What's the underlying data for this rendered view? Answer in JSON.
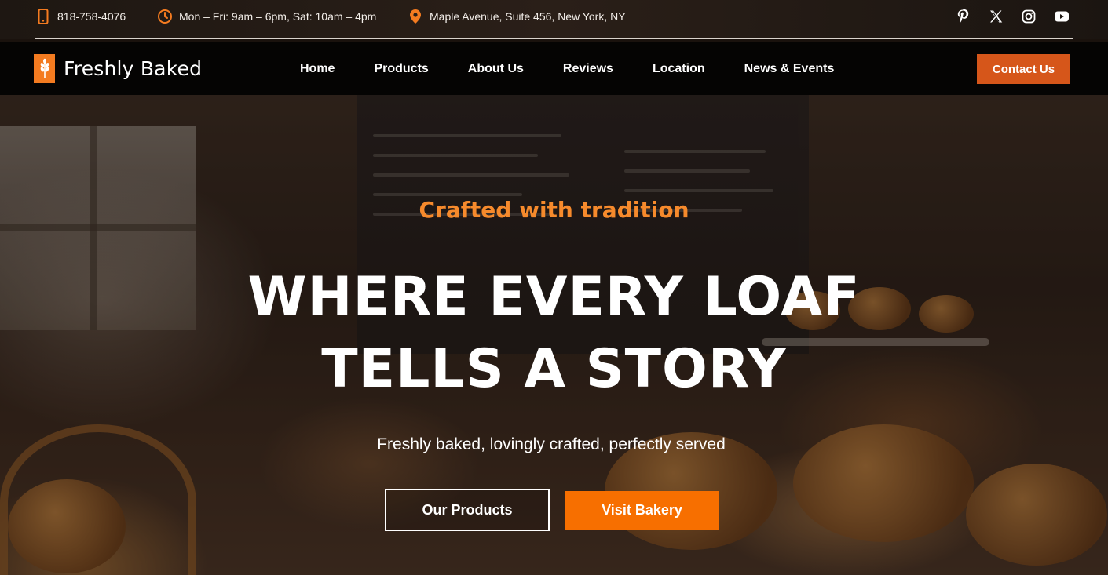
{
  "topbar": {
    "phone": "818-758-4076",
    "hours": "Mon – Fri: 9am – 6pm, Sat: 10am – 4pm",
    "address": "Maple Avenue, Suite 456, New York, NY",
    "social": [
      "pinterest-icon",
      "x-icon",
      "instagram-icon",
      "youtube-icon"
    ]
  },
  "brand": {
    "name": "Freshly Baked",
    "accent": "#f47b20"
  },
  "nav": {
    "items": [
      "Home",
      "Products",
      "About Us",
      "Reviews",
      "Location",
      "News & Events"
    ],
    "cta": "Contact Us"
  },
  "hero": {
    "eyebrow": "Crafted with tradition",
    "headline_line1": "WHERE EVERY LOAF",
    "headline_line2": "TELLS A STORY",
    "subheading": "Freshly baked, lovingly crafted, perfectly served",
    "primary_button": "Our Products",
    "secondary_button": "Visit Bakery"
  },
  "colors": {
    "eyebrow": "#f68a2c",
    "cta": "#d6561a",
    "visit_button": "#f76f00"
  }
}
